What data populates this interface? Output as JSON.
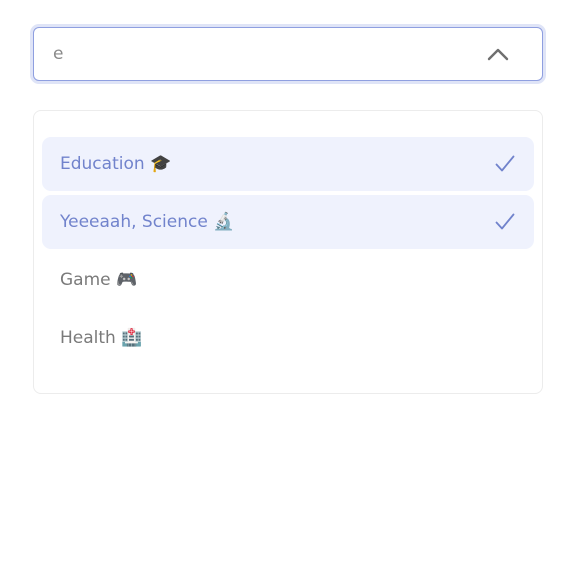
{
  "combobox": {
    "value": "e",
    "toggle_icon": "chevron-up-icon"
  },
  "options": [
    {
      "label": "Education 🎓",
      "selected": true
    },
    {
      "label": "Yeeeaah, Science 🔬",
      "selected": true
    },
    {
      "label": "Game 🎮",
      "selected": false
    },
    {
      "label": "Health 🏥",
      "selected": false
    }
  ],
  "colors": {
    "accent": "#7183cc",
    "selected_bg": "#eff2fd",
    "focus_border": "#8f9fe0",
    "text_muted": "#7a7a7a"
  }
}
